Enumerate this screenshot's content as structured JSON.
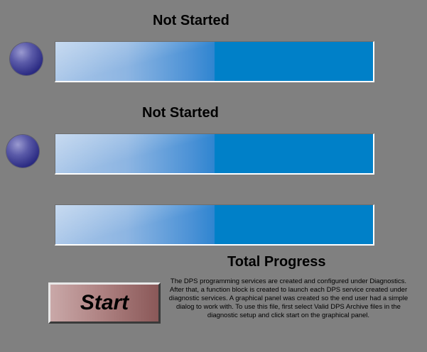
{
  "channels": [
    {
      "status": "Not Started",
      "progress": 0.5
    },
    {
      "status": "Not Started",
      "progress": 0.5
    }
  ],
  "total": {
    "label": "Total Progress",
    "progress": 0.5
  },
  "start_button": {
    "label": "Start"
  },
  "description": "The DPS programming services are created and configured under Diagnostics.  After that, a function block is created to launch each DPS service created under diagnostic services.  A graphical panel was created so the end user had a simple dialog to work with.  To use this file, first select Valid DPS Archive files in the diagnostic setup and click start on the graphical panel.",
  "colors": {
    "background": "#808080",
    "bar_track": "#0080c8",
    "bar_fill": "#8db5e2",
    "led": "#2a2a8a",
    "button": "#a87878"
  }
}
